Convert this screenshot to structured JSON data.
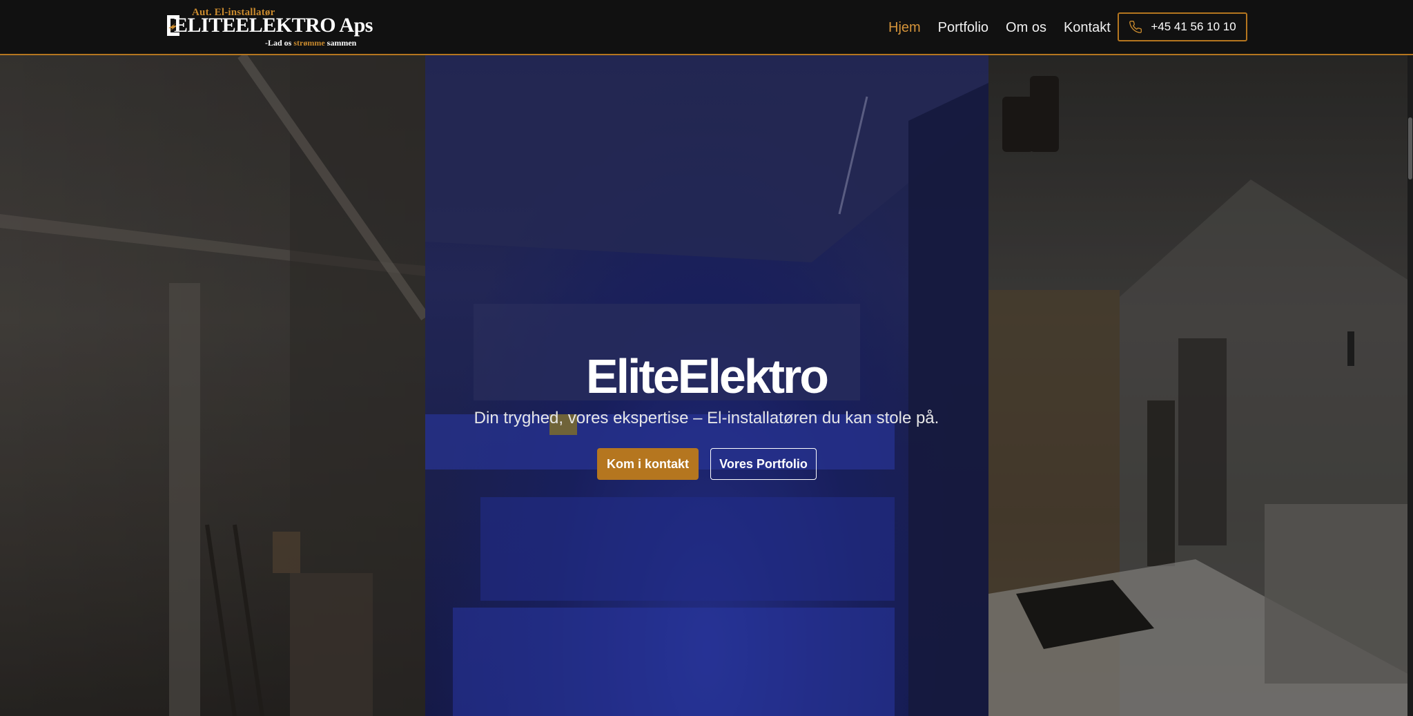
{
  "brand": {
    "logo_top": "Aut. El-installatør",
    "logo_main": "ELITEELEKTRO Aps",
    "tagline_prefix": "-Lad os",
    "tagline_highlight": "strømme",
    "tagline_suffix": "sammen"
  },
  "nav": {
    "items": [
      {
        "label": "Hjem",
        "active": true
      },
      {
        "label": "Portfolio",
        "active": false
      },
      {
        "label": "Om os",
        "active": false
      },
      {
        "label": "Kontakt",
        "active": false
      }
    ],
    "phone": "+45 41 56 10 10"
  },
  "hero": {
    "title": "EliteElektro",
    "subtitle": "Din tryghed, vores ekspertise – El-installatøren du kan stole på.",
    "primary_button": "Kom i kontakt",
    "secondary_button": "Vores Portfolio"
  },
  "colors": {
    "accent": "#b5761f",
    "nav_active": "#d4933a",
    "header_bg": "#111111"
  },
  "icons": {
    "phone": "phone-icon",
    "logo_bolt": "lightning-bolt-icon"
  }
}
